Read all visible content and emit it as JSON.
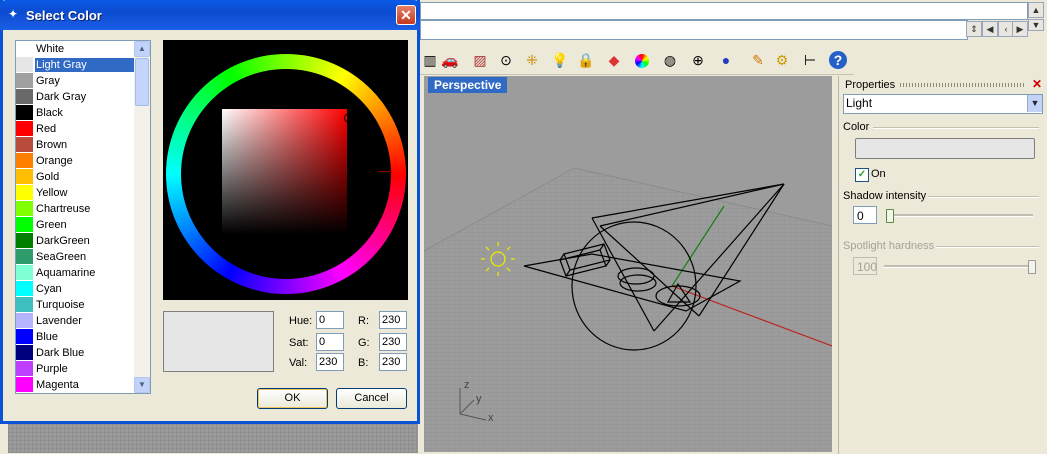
{
  "dialog": {
    "title": "Select Color",
    "colors": [
      {
        "name": "White",
        "hex": "#ffffff"
      },
      {
        "name": "Light Gray",
        "hex": "#e6e6e6"
      },
      {
        "name": "Gray",
        "hex": "#a0a0a0"
      },
      {
        "name": "Dark Gray",
        "hex": "#696969"
      },
      {
        "name": "Black",
        "hex": "#000000"
      },
      {
        "name": "Red",
        "hex": "#ff0000"
      },
      {
        "name": "Brown",
        "hex": "#b94b3c"
      },
      {
        "name": "Orange",
        "hex": "#ff7f00"
      },
      {
        "name": "Gold",
        "hex": "#ffbf00"
      },
      {
        "name": "Yellow",
        "hex": "#ffff00"
      },
      {
        "name": "Chartreuse",
        "hex": "#7fff00"
      },
      {
        "name": "Green",
        "hex": "#00ff00"
      },
      {
        "name": "DarkGreen",
        "hex": "#007f00"
      },
      {
        "name": "SeaGreen",
        "hex": "#2e9b6b"
      },
      {
        "name": "Aquamarine",
        "hex": "#7fffd4"
      },
      {
        "name": "Cyan",
        "hex": "#00ffff"
      },
      {
        "name": "Turquoise",
        "hex": "#3fbfbf"
      },
      {
        "name": "Lavender",
        "hex": "#b4b4ff"
      },
      {
        "name": "Blue",
        "hex": "#0000ff"
      },
      {
        "name": "Dark Blue",
        "hex": "#00007f"
      },
      {
        "name": "Purple",
        "hex": "#bf3fff"
      },
      {
        "name": "Magenta",
        "hex": "#ff00ff"
      }
    ],
    "selected_color": "Light Gray",
    "preview_hex": "#e6e6e6",
    "hsv": {
      "hue_label": "Hue:",
      "hue": "0",
      "sat_label": "Sat:",
      "sat": "0",
      "val_label": "Val:",
      "val": "230"
    },
    "rgb": {
      "r_label": "R:",
      "r": "230",
      "g_label": "G:",
      "g": "230",
      "b_label": "B:",
      "b": "230"
    },
    "ok_label": "OK",
    "cancel_label": "Cancel"
  },
  "viewport": {
    "title": "Perspective",
    "axis_x": "x",
    "axis_y": "y",
    "axis_z": "z"
  },
  "properties": {
    "title": "Properties",
    "object_type": "Light",
    "color_section": "Color",
    "on_label": "On",
    "on_checked": true,
    "shadow_label": "Shadow intensity",
    "shadow_value": "0",
    "shadow_level": 0,
    "spotlight_label": "Spotlight hardness",
    "spotlight_value": "100",
    "spotlight_level": 1
  },
  "toolbar_icons": [
    "layer-icon",
    "car-icon",
    "render-mesh-icon",
    "target-icon",
    "points-icon",
    "lightbulb-icon",
    "lock-icon",
    "material-icon",
    "color-wheel-icon",
    "sphere-outline-icon",
    "grid-sphere-icon",
    "blue-sphere-icon",
    "pen-icon",
    "gears-icon",
    "tree-icon",
    "help-icon"
  ],
  "colors": {
    "title_bar": "#0a5ae6",
    "selection": "#316ac5",
    "viewport_bg": "#9c9c9c"
  }
}
